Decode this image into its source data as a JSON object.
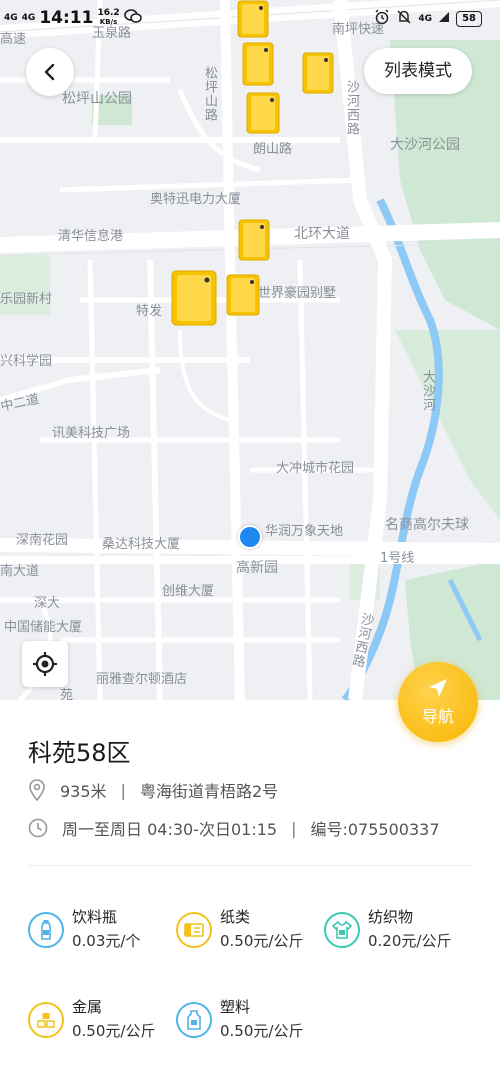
{
  "status_bar": {
    "signal_1": "4G",
    "signal_2": "4G",
    "time": "14:11",
    "speed_value": "16.2",
    "speed_unit": "KB/s",
    "net_type": "4G",
    "battery": "58"
  },
  "map": {
    "list_mode_label": "列表模式",
    "labels": {
      "nanping": "南坪快速",
      "yuquan": "玉泉路",
      "gaosu": "高速",
      "songpingshan_park": "松坪山公园",
      "songpingshan_road": "松坪山路",
      "shahe_west": "沙河西路",
      "langshan": "朗山路",
      "dashahe_park": "大沙河公园",
      "aotexun": "奥特迅电力大厦",
      "qinghua": "清华信息港",
      "beihuan": "北环大道",
      "yuan_xincheng": "乐园新村",
      "shijie": "世界豪园别墅",
      "tefa": "特发",
      "xingkexue": "兴科学园",
      "zhonger": "中二道",
      "dashahe": "大沙河",
      "xunmei": "讯美科技广场",
      "dachong": "大冲城市花园",
      "shennan_garden": "深南花园",
      "sangda": "桑达科技大厦",
      "huarun": "华润万象天地",
      "mingshang": "名商高尔夫球",
      "gaoxinyuan": "高新园",
      "line1": "1号线",
      "nandadao": "南大道",
      "chuangwei": "创维大厦",
      "shenda": "深大",
      "zhongguo_chuneng": "中国储能大厦",
      "shahe_west_2": "沙河西路",
      "ritz": "丽雅查尔顿酒店",
      "yuan": "苑"
    }
  },
  "nav_button_label": "导航",
  "station": {
    "name": "科苑58区",
    "distance": "935米",
    "address": "粤海街道青梧路2号",
    "hours": "周一至周日 04:30-次日01:15",
    "code": "编号:075500337"
  },
  "items": [
    {
      "name": "饮料瓶",
      "price": "0.03元/个",
      "icon": "bottle-icon",
      "color": "#4fb3e8"
    },
    {
      "name": "纸类",
      "price": "0.50元/公斤",
      "icon": "paper-icon",
      "color": "#f2c21b"
    },
    {
      "name": "纺织物",
      "price": "0.20元/公斤",
      "icon": "textile-icon",
      "color": "#3cc7b4"
    },
    {
      "name": "金属",
      "price": "0.50元/公斤",
      "icon": "metal-icon",
      "color": "#f2c21b"
    },
    {
      "name": "塑料",
      "price": "0.50元/公斤",
      "icon": "plastic-icon",
      "color": "#4fb3e8"
    }
  ],
  "colors": {
    "accent": "#f7b500",
    "user_location": "#1e88f0",
    "bin": "#f5c400"
  }
}
